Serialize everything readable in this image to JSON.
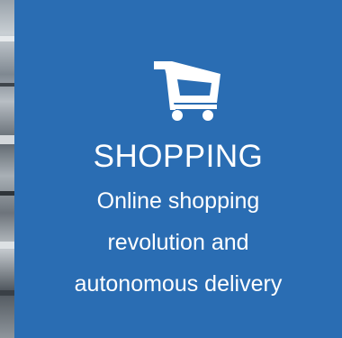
{
  "tile": {
    "icon": "shopping-cart-icon",
    "title": "SHOPPING",
    "description_lines": [
      "Online shopping",
      "revolution and",
      "autonomous delivery"
    ],
    "background_color": "#2a6db3",
    "text_color": "#ffffff"
  }
}
